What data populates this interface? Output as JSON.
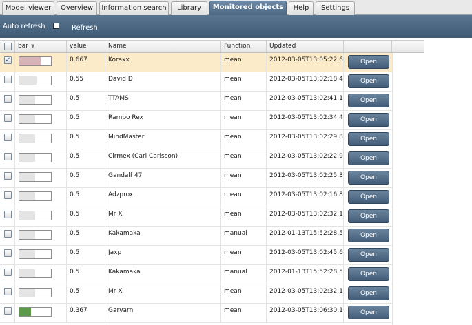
{
  "tabs": [
    {
      "label": "Model viewer",
      "active": false
    },
    {
      "label": "Overview",
      "active": false
    },
    {
      "label": "Information search",
      "active": false
    },
    {
      "label": "Library",
      "active": false
    },
    {
      "label": "Monitored objects",
      "active": true
    },
    {
      "label": "Help",
      "active": false
    },
    {
      "label": "Settings",
      "active": false
    }
  ],
  "toolbar": {
    "auto_refresh_label": "Auto refresh",
    "auto_refresh_checked": false,
    "refresh_label": "Refresh"
  },
  "table": {
    "columns": {
      "bar": "bar",
      "value": "value",
      "name": "Name",
      "function": "Function",
      "updated": "Updated"
    },
    "sort_column": "bar",
    "open_label": "Open",
    "rows": [
      {
        "checked": true,
        "selected": true,
        "bar": 0.667,
        "bar_color": "#d8b4b8",
        "value": "0.667",
        "name": "Koraxx",
        "function": "mean",
        "updated": "2012-03-05T13:05:22.6"
      },
      {
        "checked": false,
        "selected": false,
        "bar": 0.55,
        "bar_color": "#e4e4e4",
        "value": "0.55",
        "name": "David D",
        "function": "mean",
        "updated": "2012-03-05T13:02:18.4"
      },
      {
        "checked": false,
        "selected": false,
        "bar": 0.5,
        "bar_color": "#e4e4e4",
        "value": "0.5",
        "name": "TTAMS",
        "function": "mean",
        "updated": "2012-03-05T13:02:41.1"
      },
      {
        "checked": false,
        "selected": false,
        "bar": 0.5,
        "bar_color": "#e4e4e4",
        "value": "0.5",
        "name": "Rambo Rex",
        "function": "mean",
        "updated": "2012-03-05T13:02:34.4"
      },
      {
        "checked": false,
        "selected": false,
        "bar": 0.5,
        "bar_color": "#e4e4e4",
        "value": "0.5",
        "name": "MindMaster",
        "function": "mean",
        "updated": "2012-03-05T13:02:29.8"
      },
      {
        "checked": false,
        "selected": false,
        "bar": 0.5,
        "bar_color": "#e4e4e4",
        "value": "0.5",
        "name": "Cirmex (Carl Carlsson)",
        "function": "mean",
        "updated": "2012-03-05T13:02:22.9"
      },
      {
        "checked": false,
        "selected": false,
        "bar": 0.5,
        "bar_color": "#e4e4e4",
        "value": "0.5",
        "name": "Gandalf 47",
        "function": "mean",
        "updated": "2012-03-05T13:02:25.3"
      },
      {
        "checked": false,
        "selected": false,
        "bar": 0.5,
        "bar_color": "#e4e4e4",
        "value": "0.5",
        "name": "Adzprox",
        "function": "mean",
        "updated": "2012-03-05T13:02:16.8"
      },
      {
        "checked": false,
        "selected": false,
        "bar": 0.5,
        "bar_color": "#e4e4e4",
        "value": "0.5",
        "name": "Mr X",
        "function": "mean",
        "updated": "2012-03-05T13:02:32.1"
      },
      {
        "checked": false,
        "selected": false,
        "bar": 0.5,
        "bar_color": "#e4e4e4",
        "value": "0.5",
        "name": "Kakamaka",
        "function": "manual",
        "updated": "2012-01-13T15:52:28.5"
      },
      {
        "checked": false,
        "selected": false,
        "bar": 0.5,
        "bar_color": "#e4e4e4",
        "value": "0.5",
        "name": "Jaxp",
        "function": "mean",
        "updated": "2012-03-05T13:02:45.6"
      },
      {
        "checked": false,
        "selected": false,
        "bar": 0.5,
        "bar_color": "#e4e4e4",
        "value": "0.5",
        "name": "Kakamaka",
        "function": "manual",
        "updated": "2012-01-13T15:52:28.5"
      },
      {
        "checked": false,
        "selected": false,
        "bar": 0.5,
        "bar_color": "#e4e4e4",
        "value": "0.5",
        "name": "Mr X",
        "function": "mean",
        "updated": "2012-03-05T13:02:32.1"
      },
      {
        "checked": false,
        "selected": false,
        "bar": 0.367,
        "bar_color": "#5c9a4a",
        "value": "0.367",
        "name": "Garvarn",
        "function": "mean",
        "updated": "2012-03-05T13:06:30.1"
      }
    ]
  },
  "colors": {
    "accent": "#4c6782",
    "selected_row": "#fcebc9"
  }
}
